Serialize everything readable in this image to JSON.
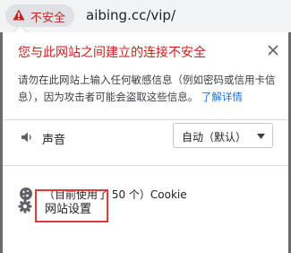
{
  "address_bar": {
    "security_chip": "不安全",
    "url": "aibing.cc/vip/"
  },
  "popup": {
    "title": "您与此网站之间建立的连接不安全",
    "description": "请勿在此网站上输入任何敏感信息（例如密码或信用卡信息），因为攻击者可能会盗取这些信息。",
    "learn_more": "了解详情",
    "sound": {
      "label": "声音",
      "selected": "自动（默认）"
    },
    "cookies": {
      "label": "（目前使用了 50 个）Cookie"
    },
    "site_settings": {
      "label": "网站设置"
    }
  },
  "colors": {
    "warning_red": "#c5221f",
    "link_blue": "#1a73e8",
    "highlight_box": "#e53935"
  },
  "icons": [
    "warning-icon",
    "close-icon",
    "speaker-icon",
    "dropdown-arrow-icon",
    "cookie-icon",
    "gear-icon"
  ]
}
